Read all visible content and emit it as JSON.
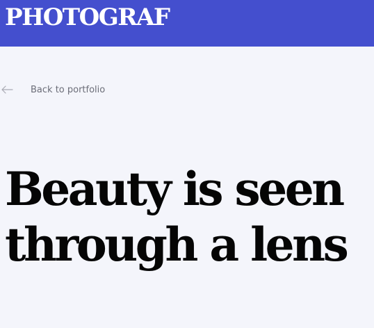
{
  "header": {
    "logo_text": "PHOTOGRAF",
    "background_color": "#444fce"
  },
  "nav": {
    "back_icon": "arrow-left-icon",
    "back_label": "Back to portfolio"
  },
  "hero": {
    "headline_line_1": "Beauty is seen",
    "headline_line_2": "through a lens"
  }
}
